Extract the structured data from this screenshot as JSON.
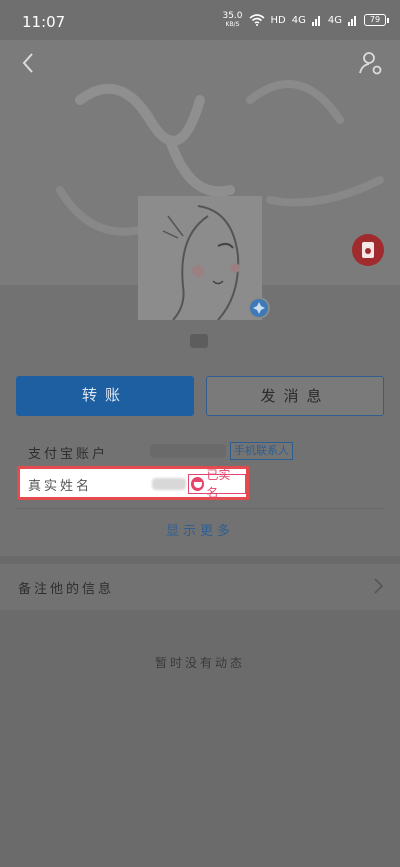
{
  "status_bar": {
    "time": "11:07",
    "speed_value": "35.0",
    "speed_unit": "KB/S",
    "hd": "HD",
    "signal1": "4G",
    "signal2": "4G",
    "battery": "79"
  },
  "header": {
    "back_icon": "chevron-left-icon",
    "profile_icon": "person-settings-icon"
  },
  "actions": {
    "transfer_label": "转账",
    "message_label": "发消息"
  },
  "info": {
    "account_label": "支付宝账户",
    "phone_contact_badge": "手机联系人",
    "realname_label": "真实姓名",
    "realname_badge": "已实名"
  },
  "show_more": "显示更多",
  "remark_label": "备注他的信息",
  "empty_state": "暂时没有动态",
  "colors": {
    "primary": "#1e5fa2",
    "highlight": "#e34b4f",
    "verified": "#e6436d"
  }
}
